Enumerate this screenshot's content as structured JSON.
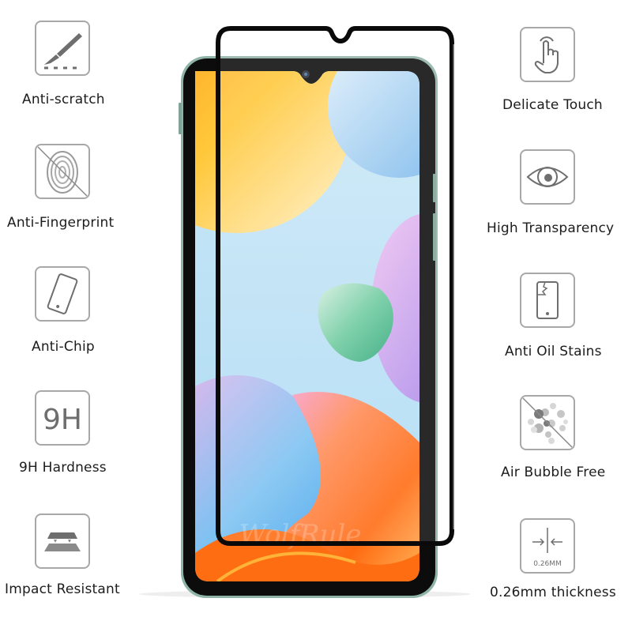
{
  "left_features": [
    {
      "label": "Anti-scratch",
      "icon": "scalpel-icon"
    },
    {
      "label": "Anti-Fingerprint",
      "icon": "fingerprint-crossed-icon"
    },
    {
      "label": "Anti-Chip",
      "icon": "tilted-phone-icon"
    },
    {
      "label": "9H Hardness",
      "icon": "9h-icon",
      "icon_text": "9H"
    },
    {
      "label": "Impact Resistant",
      "icon": "layers-icon"
    }
  ],
  "right_features": [
    {
      "label": "Delicate Touch",
      "icon": "touch-hand-icon"
    },
    {
      "label": "High Transparency",
      "icon": "eye-icon"
    },
    {
      "label": "Anti Oil Stains",
      "icon": "cracked-phone-icon"
    },
    {
      "label": "Air Bubble Free",
      "icon": "bubbles-crossed-icon"
    },
    {
      "label": "0.26mm thickness",
      "icon": "thickness-icon",
      "icon_text": "0.26MM"
    }
  ],
  "watermark": "WolfRule",
  "colors": {
    "icon_stroke": "#a8a8a8",
    "icon_fill": "#6e6e6e",
    "phone_frame": "#8fb3a6",
    "protector_border": "#0a0a0a"
  }
}
